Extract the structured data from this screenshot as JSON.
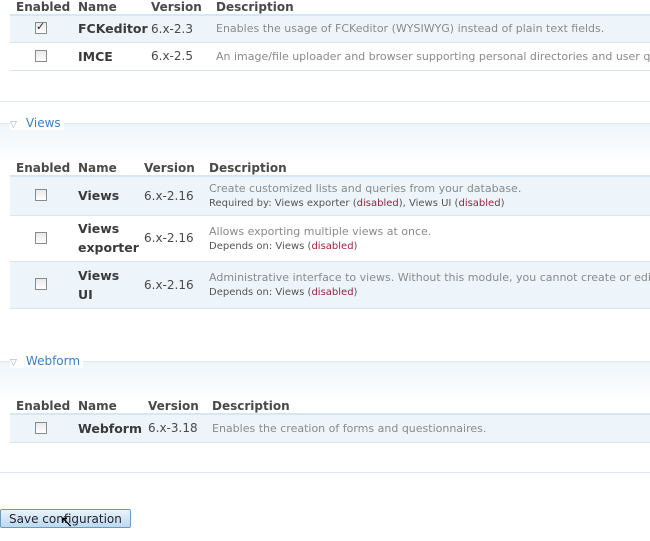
{
  "columns": {
    "enabled": "Enabled",
    "name": "Name",
    "version": "Version",
    "description": "Description"
  },
  "sections": [
    {
      "legend": "",
      "modules": [
        {
          "name": "FCKeditor",
          "version": "6.x-2.3",
          "enabled": true,
          "description": "Enables the usage of FCKeditor (WYSIWYG) instead of plain text fields."
        },
        {
          "name": "IMCE",
          "version": "6.x-2.5",
          "enabled": false,
          "description": "An image/file uploader and browser supporting personal directories and user q"
        }
      ]
    },
    {
      "legend": "Views",
      "modules": [
        {
          "name": "Views",
          "version": "6.x-2.16",
          "enabled": false,
          "description": "Create customized lists and queries from your database.",
          "dep_label": "Required by: Views exporter (",
          "dep_status": "disabled",
          "dep_mid": "), Views UI (",
          "dep_status2": "disabled",
          "dep_end": ")"
        },
        {
          "name": "Views exporter",
          "version": "6.x-2.16",
          "enabled": false,
          "description": "Allows exporting multiple views at once.",
          "dep_label": "Depends on: Views (",
          "dep_status": "disabled",
          "dep_end": ")"
        },
        {
          "name": "Views UI",
          "version": "6.x-2.16",
          "enabled": false,
          "description": "Administrative interface to views. Without this module, you cannot create or edit",
          "dep_label": "Depends on: Views (",
          "dep_status": "disabled",
          "dep_end": ")"
        }
      ]
    },
    {
      "legend": "Webform",
      "modules": [
        {
          "name": "Webform",
          "version": "6.x-3.18",
          "enabled": false,
          "description": "Enables the creation of forms and questionnaires."
        }
      ]
    }
  ],
  "save_label": "Save configuration",
  "colors": {
    "row_odd": "#edf5fa",
    "legend": "#3a7fc0",
    "disabled": "#a02040"
  }
}
